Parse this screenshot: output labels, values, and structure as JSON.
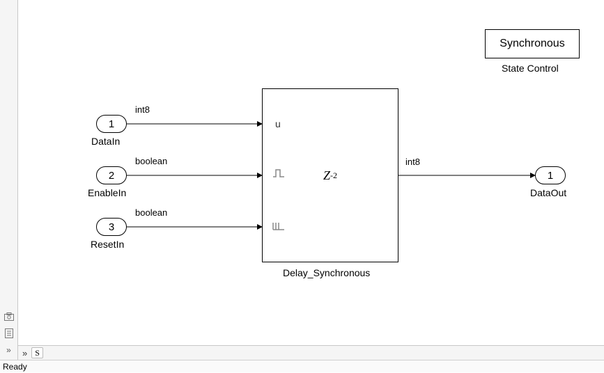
{
  "status": {
    "text": "Ready"
  },
  "bottombar": {
    "chip": "S"
  },
  "sidebar": {
    "snapshot": "⎡⎦",
    "other": "⎙",
    "expand": "»"
  },
  "diagram": {
    "inports": [
      {
        "num": "1",
        "name": "DataIn",
        "sigtype": "int8"
      },
      {
        "num": "2",
        "name": "EnableIn",
        "sigtype": "boolean"
      },
      {
        "num": "3",
        "name": "ResetIn",
        "sigtype": "boolean"
      }
    ],
    "outport": {
      "num": "1",
      "name": "DataOut",
      "sigtype": "int8"
    },
    "delay_block": {
      "label": "Delay_Synchronous",
      "center_text_base": "Z",
      "center_text_exp": "-2",
      "port_u": "u"
    },
    "state_block": {
      "text": "Synchronous",
      "label": "State Control"
    }
  }
}
